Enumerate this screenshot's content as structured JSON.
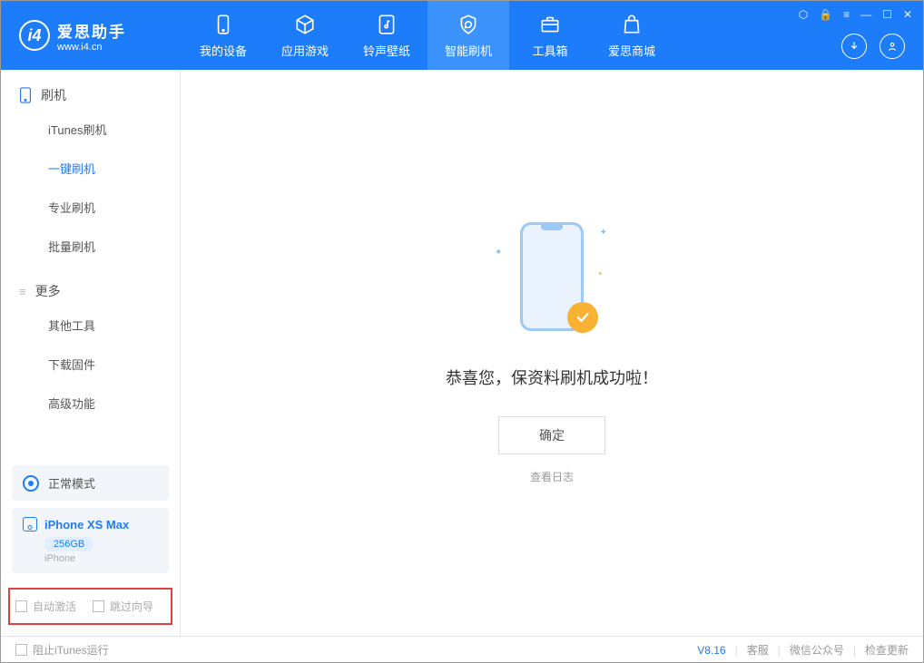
{
  "app": {
    "title": "爱思助手",
    "subtitle": "www.i4.cn"
  },
  "nav": [
    {
      "label": "我的设备"
    },
    {
      "label": "应用游戏"
    },
    {
      "label": "铃声壁纸"
    },
    {
      "label": "智能刷机",
      "active": true
    },
    {
      "label": "工具箱"
    },
    {
      "label": "爱思商城"
    }
  ],
  "sidebar": {
    "section1": "刷机",
    "items1": [
      "iTunes刷机",
      "一键刷机",
      "专业刷机",
      "批量刷机"
    ],
    "section2": "更多",
    "items2": [
      "其他工具",
      "下载固件",
      "高级功能"
    ]
  },
  "mode": {
    "label": "正常模式"
  },
  "device": {
    "name": "iPhone XS Max",
    "storage": "256GB",
    "type": "iPhone"
  },
  "checks": {
    "autoActivate": "自动激活",
    "skipGuide": "跳过向导"
  },
  "main": {
    "successMsg": "恭喜您，保资料刷机成功啦！",
    "okBtn": "确定",
    "logLink": "查看日志"
  },
  "footer": {
    "blockItunes": "阻止iTunes运行",
    "version": "V8.16",
    "link1": "客服",
    "link2": "微信公众号",
    "link3": "检查更新"
  }
}
